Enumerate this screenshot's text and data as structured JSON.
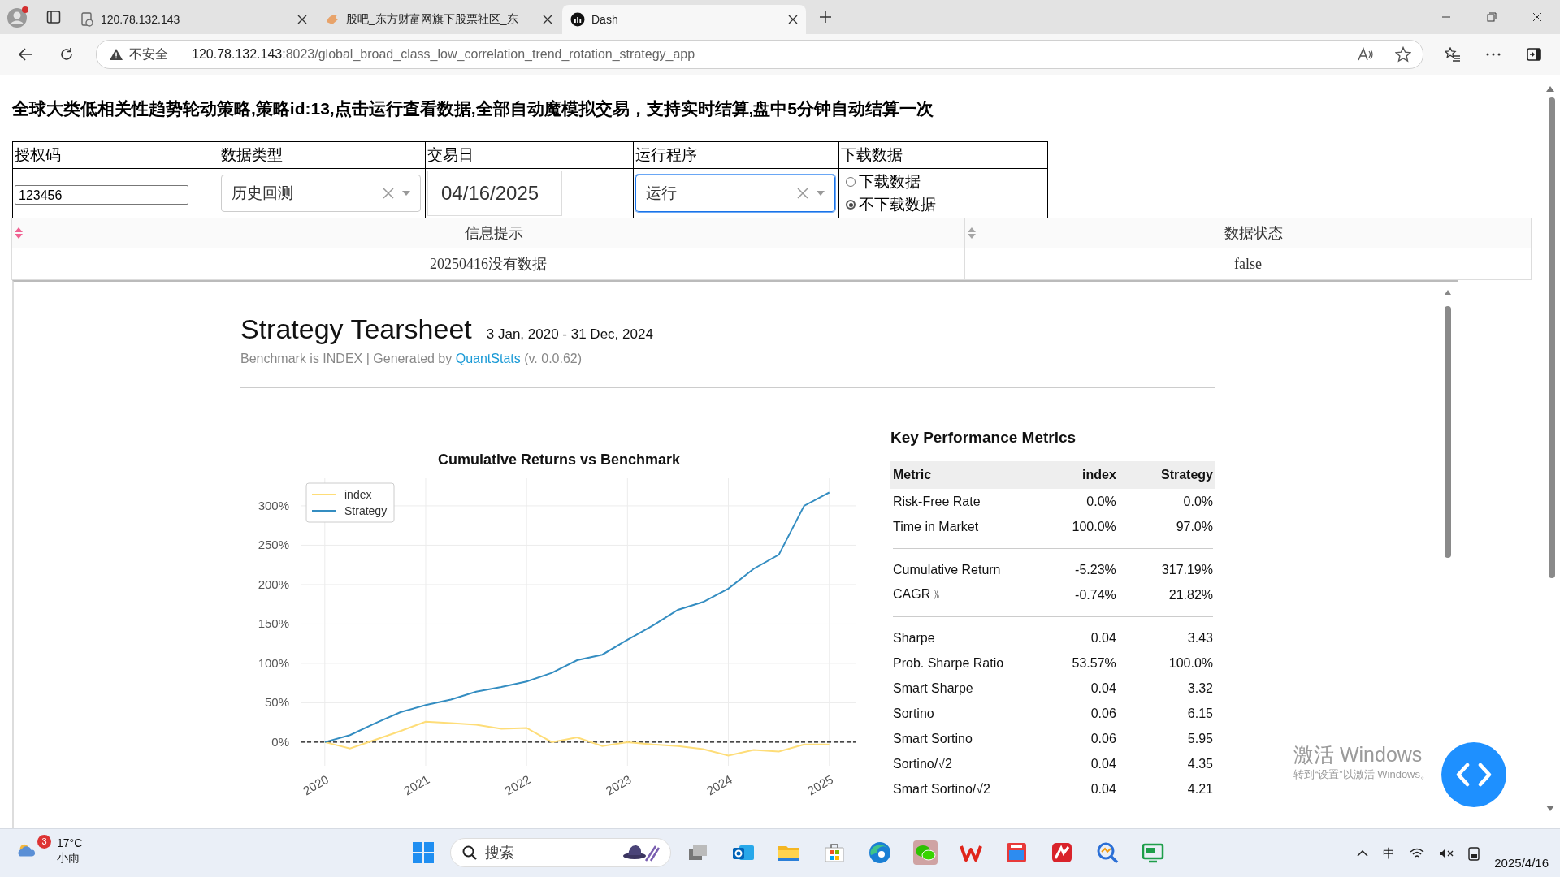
{
  "browser": {
    "tabs": [
      {
        "title": "120.78.132.143",
        "selected": false
      },
      {
        "title": "股吧_东方财富网旗下股票社区_东",
        "selected": false
      },
      {
        "title": "Dash",
        "selected": true
      }
    ],
    "address_bar": {
      "security": "不安全",
      "host": "120.78.132.143",
      "path": ":8023/global_broad_class_low_correlation_trend_rotation_strategy_app"
    }
  },
  "page": {
    "heading": "全球大类低相关性趋势轮动策略,策略id:13,点击运行查看数据,全部自动魔模拟交易，支持实时结算,盘中5分钟自动结算一次",
    "form": {
      "fields": [
        {
          "kind": "text",
          "label": "授权码",
          "value": "123456"
        },
        {
          "kind": "dropdown",
          "label": "数据类型",
          "value": "历史回测",
          "focused": false
        },
        {
          "kind": "date",
          "label": "交易日",
          "value": "04/16/2025"
        },
        {
          "kind": "dropdown",
          "label": "运行程序",
          "value": "运行",
          "focused": true
        },
        {
          "kind": "radio",
          "label": "下载数据",
          "options": [
            {
              "label": "下载数据",
              "selected": false
            },
            {
              "label": "不下载数据",
              "selected": true
            }
          ]
        }
      ]
    },
    "status_table": {
      "columns": [
        {
          "label": "信息提示",
          "color": "#f06292"
        },
        {
          "label": "数据状态",
          "color": "#a6a6a6"
        }
      ],
      "rows": [
        [
          "20250416没有数据",
          "false"
        ]
      ]
    },
    "tearsheet": {
      "title": "Strategy Tearsheet",
      "date_range": "3 Jan, 2020 - 31 Dec, 2024",
      "subtitle_before": "Benchmark is INDEX | Generated by ",
      "subtitle_link": "QuantStats",
      "subtitle_after": " (v. 0.0.62)",
      "chart_data": {
        "type": "line",
        "title": "Cumulative Returns vs Benchmark",
        "x": [
          2020,
          2020.25,
          2020.5,
          2020.75,
          2021,
          2021.25,
          2021.5,
          2021.75,
          2022,
          2022.25,
          2022.5,
          2022.75,
          2023,
          2023.25,
          2023.5,
          2023.75,
          2024,
          2024.25,
          2024.5,
          2024.75,
          2025
        ],
        "series": [
          {
            "name": "index",
            "color": "#fedd78",
            "values": [
              0,
              -8,
              3,
              14,
              26,
              24,
              22,
              17,
              18,
              0,
              6,
              -5,
              0,
              -3,
              -5,
              -9,
              -17,
              -10,
              -12,
              -3,
              -3
            ]
          },
          {
            "name": "Strategy",
            "color": "#348dc1",
            "values": [
              0,
              9,
              24,
              38,
              47,
              54,
              64,
              70,
              77,
              88,
              104,
              111,
              130,
              148,
              168,
              178,
              195,
              220,
              238,
              300,
              317
            ]
          }
        ],
        "xlim": [
          2019.76,
          2025.26
        ],
        "ylim": [
          -30,
          335
        ],
        "grid": true,
        "legend": true,
        "ref_lines": [
          {
            "axis": "y",
            "value": 0,
            "color": "#111111"
          }
        ],
        "xticks": [
          {
            "value": 2020,
            "label": "2020"
          },
          {
            "value": 2021,
            "label": "2021"
          },
          {
            "value": 2022,
            "label": "2022"
          },
          {
            "value": 2023,
            "label": "2023"
          },
          {
            "value": 2024,
            "label": "2024"
          },
          {
            "value": 2025,
            "label": "2025"
          }
        ],
        "yticks": [
          {
            "value": 0,
            "label": "0%"
          },
          {
            "value": 50,
            "label": "50%"
          },
          {
            "value": 100,
            "label": "100%"
          },
          {
            "value": 150,
            "label": "150%"
          },
          {
            "value": 200,
            "label": "200%"
          },
          {
            "value": 250,
            "label": "250%"
          },
          {
            "value": 300,
            "label": "300%"
          }
        ]
      },
      "metrics": {
        "title": "Key Performance Metrics",
        "columns": [
          "Metric",
          "index",
          "Strategy"
        ],
        "groups": [
          [
            [
              "Risk-Free Rate",
              "0.0%",
              "0.0%"
            ],
            [
              "Time in Market",
              "100.0%",
              "97.0%"
            ]
          ],
          [
            [
              "Cumulative Return",
              "-5.23%",
              "317.19%"
            ],
            [
              "CAGR﹪",
              "-0.74%",
              "21.82%"
            ]
          ],
          [
            [
              "Sharpe",
              "0.04",
              "3.43"
            ],
            [
              "Prob. Sharpe Ratio",
              "53.57%",
              "100.0%"
            ],
            [
              "Smart Sharpe",
              "0.04",
              "3.32"
            ],
            [
              "Sortino",
              "0.06",
              "6.15"
            ],
            [
              "Smart Sortino",
              "0.06",
              "5.95"
            ],
            [
              "Sortino/√2",
              "0.04",
              "4.35"
            ],
            [
              "Smart Sortino/√2",
              "0.04",
              "4.21"
            ]
          ]
        ]
      }
    }
  },
  "activation": {
    "title": "激活 Windows",
    "hint": "转到“设置”以激活 Windows。"
  },
  "taskbar": {
    "weather": {
      "badge": "3",
      "temperature": "17°C",
      "condition": "小雨"
    },
    "search": {
      "placeholder": "搜索"
    },
    "ime": "中",
    "date": "2025/4/16"
  }
}
